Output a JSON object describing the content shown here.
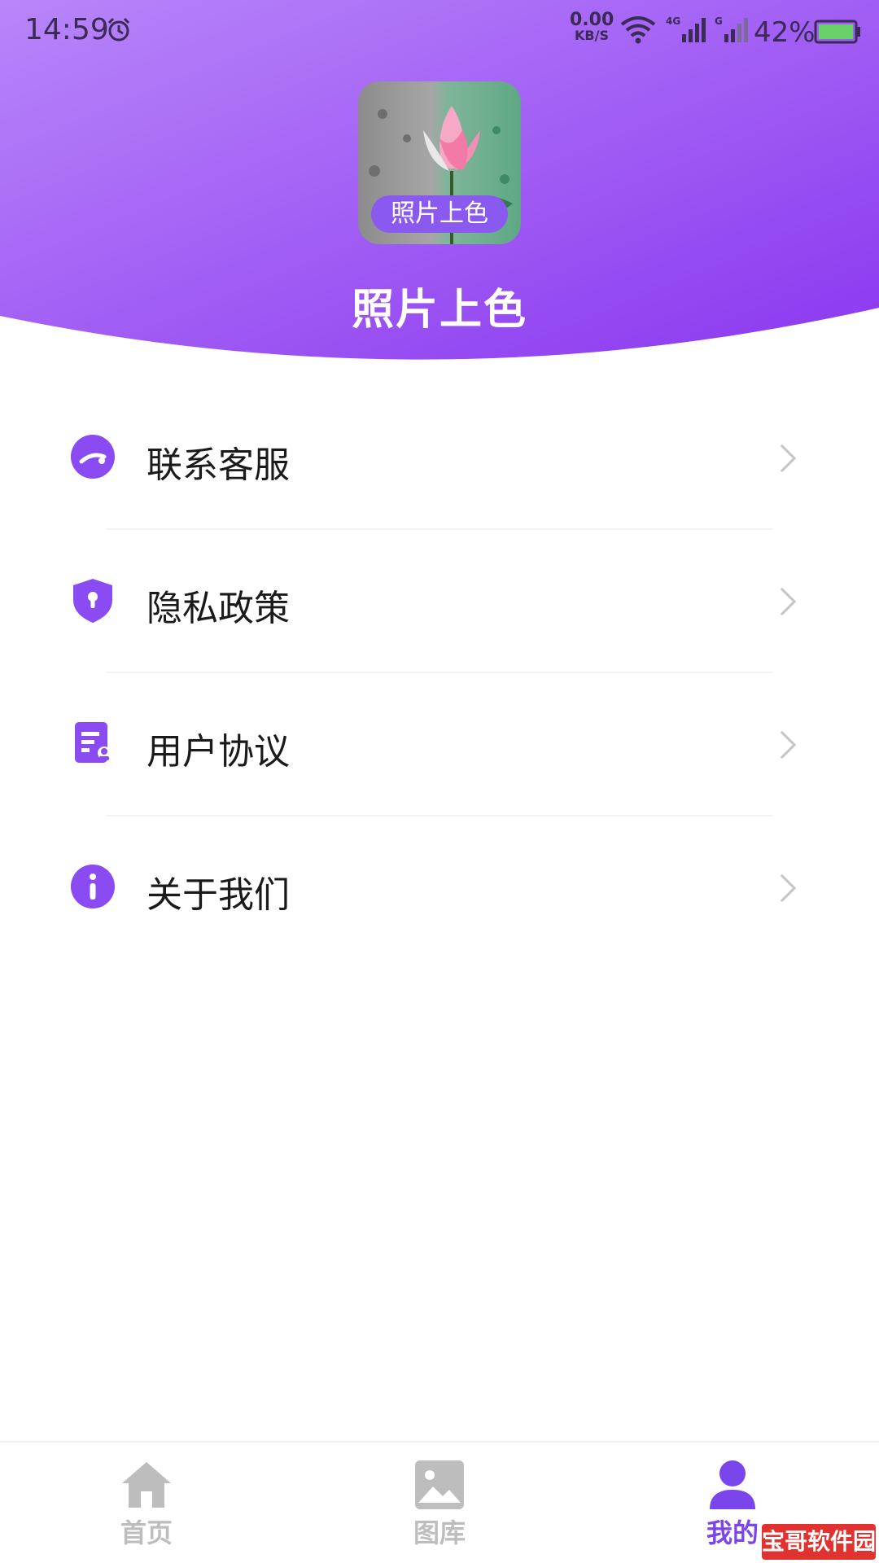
{
  "status_bar": {
    "time": "14:59",
    "net_speed_value": "0.00",
    "net_speed_unit": "KB/S",
    "battery_percent": "42%",
    "icons": [
      "alarm-icon",
      "wifi-icon",
      "signal-4g-icon",
      "signal-g-icon",
      "battery-icon"
    ]
  },
  "header": {
    "logo_badge": "照片上色",
    "app_name": "照片上色"
  },
  "menu": {
    "items": [
      {
        "label": "联系客服",
        "icon": "customer-service-icon"
      },
      {
        "label": "隐私政策",
        "icon": "shield-icon"
      },
      {
        "label": "用户协议",
        "icon": "document-icon"
      },
      {
        "label": "关于我们",
        "icon": "info-icon"
      }
    ]
  },
  "tabbar": {
    "tabs": [
      {
        "label": "首页",
        "icon": "home-icon",
        "active": false
      },
      {
        "label": "图库",
        "icon": "gallery-icon",
        "active": false
      },
      {
        "label": "我的",
        "icon": "user-icon",
        "active": true
      }
    ]
  },
  "watermark": "宝哥软件园",
  "colors": {
    "accent": "#8a4cf2",
    "header_gradient_start": "#b07cf8",
    "header_gradient_end": "#8f3df0",
    "inactive": "#bdbdbd"
  }
}
